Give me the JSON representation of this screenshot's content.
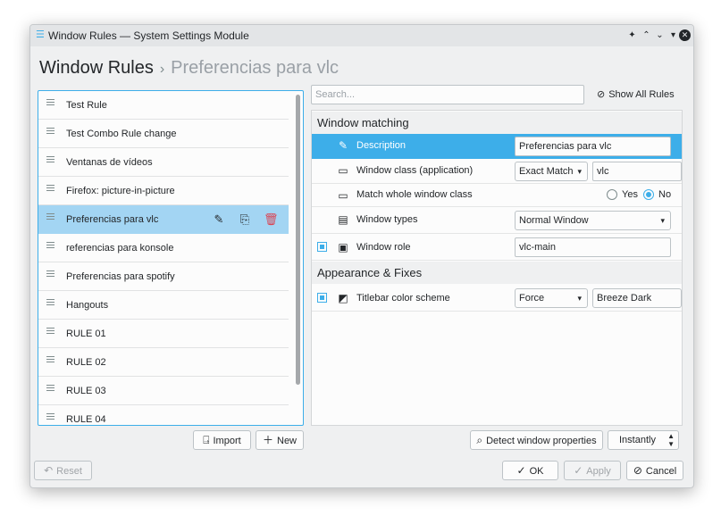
{
  "window": {
    "title": "Window Rules — System Settings Module"
  },
  "breadcrumb": {
    "root": "Window Rules",
    "current": "Preferencias para vlc"
  },
  "rules": [
    {
      "label": "Test Rule"
    },
    {
      "label": "Test Combo Rule change"
    },
    {
      "label": "Ventanas de vídeos"
    },
    {
      "label": "Firefox: picture-in-picture"
    },
    {
      "label": "Preferencias para vlc",
      "selected": true
    },
    {
      "label": "referencias para konsole"
    },
    {
      "label": "Preferencias para spotify"
    },
    {
      "label": "Hangouts"
    },
    {
      "label": "RULE 01"
    },
    {
      "label": "RULE 02"
    },
    {
      "label": "RULE 03"
    },
    {
      "label": "RULE 04"
    }
  ],
  "list_actions": {
    "import_label": "Import",
    "new_label": "New"
  },
  "search": {
    "placeholder": "Search..."
  },
  "show_all_label": "Show All Rules",
  "sections": {
    "matching": "Window matching",
    "appearance": "Appearance & Fixes"
  },
  "props": {
    "description": {
      "label": "Description",
      "value": "Preferencias para vlc"
    },
    "window_class": {
      "label": "Window class (application)",
      "match": "Exact Match",
      "value": "vlc"
    },
    "whole_class": {
      "label": "Match whole window class",
      "yes": "Yes",
      "no": "No",
      "selected": "No"
    },
    "window_types": {
      "label": "Window types",
      "value": "Normal Window"
    },
    "window_role": {
      "label": "Window role",
      "value": "vlc-main",
      "enabled": true
    },
    "titlebar": {
      "label": "Titlebar color scheme",
      "policy": "Force",
      "value": "Breeze Dark",
      "enabled": true
    }
  },
  "detect": {
    "label": "Detect window properties",
    "delay": "Instantly"
  },
  "footer": {
    "reset_label": "Reset",
    "ok_label": "OK",
    "apply_label": "Apply",
    "cancel_label": "Cancel"
  },
  "colors": {
    "accent": "#3daee9",
    "selection_row": "#a3d5f3",
    "delete": "#da4453",
    "window_bg": "#eff0f1"
  },
  "icons": [
    "window-icon",
    "pin-icon",
    "chevron-up-icon",
    "chevron-down-icon",
    "close-icon",
    "drag-handle-icon",
    "edit-icon",
    "export-icon",
    "delete-icon",
    "import-icon",
    "add-icon",
    "hidden-eye-icon",
    "pencil-icon",
    "window-frame-icon",
    "window-types-icon",
    "window-role-icon",
    "color-scheme-icon",
    "detect-icon",
    "reset-icon",
    "check-icon",
    "apply-icon",
    "cancel-icon"
  ]
}
